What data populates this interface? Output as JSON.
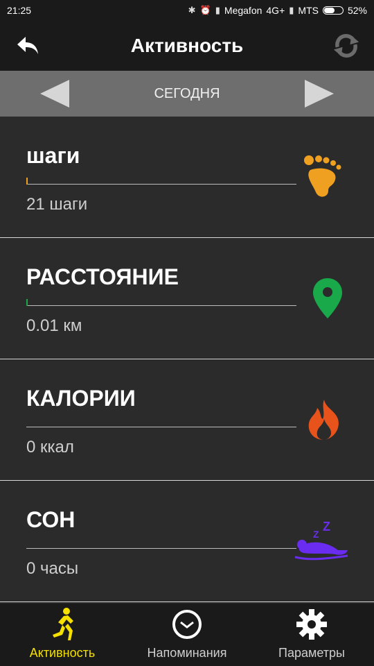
{
  "status": {
    "time": "21:25",
    "carrier1": "Megafon",
    "network": "4G+",
    "carrier2": "MTS",
    "battery": "52%"
  },
  "header": {
    "title": "Активность"
  },
  "datebar": {
    "label": "СЕГОДНЯ"
  },
  "cards": [
    {
      "name": "шаги",
      "value": "21 шаги",
      "accent": "#f0a020"
    },
    {
      "name": "РАССТОЯНИЕ",
      "value": "0.01 км",
      "accent": "#19a84a"
    },
    {
      "name": "КАЛОРИИ",
      "value": "0 ккал",
      "accent": "#e8531b"
    },
    {
      "name": "СОН",
      "value": "0 часы",
      "accent": "#6a2cf0"
    }
  ],
  "nav": [
    {
      "label": "Активность",
      "icon": "runner-icon",
      "active": true
    },
    {
      "label": "Напоминания",
      "icon": "clock-icon",
      "active": false
    },
    {
      "label": "Параметры",
      "icon": "gear-icon",
      "active": false
    }
  ]
}
